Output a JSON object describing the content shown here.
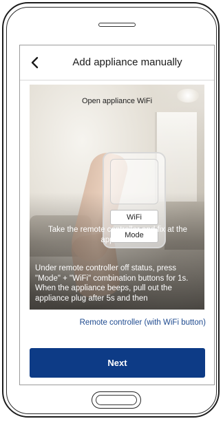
{
  "header": {
    "title": "Add appliance manually",
    "back_icon": "chevron-left-icon"
  },
  "illustration": {
    "heading": "Open appliance WiFi",
    "remote_buttons": {
      "wifi": "WiFi",
      "mode": "Mode"
    },
    "caption": "Take the remote controller and fix at the appliance",
    "instructions": "Under remote controller off status, press \"Mode\" + \"WiFi\" combination buttons for 1s. When the appliance beeps, pull out the appliance plug after 5s and then"
  },
  "remote_caption": "Remote controller (with WiFi button)",
  "next_label": "Next",
  "colors": {
    "primary": "#0d3b86",
    "link": "#1e4a8f"
  }
}
